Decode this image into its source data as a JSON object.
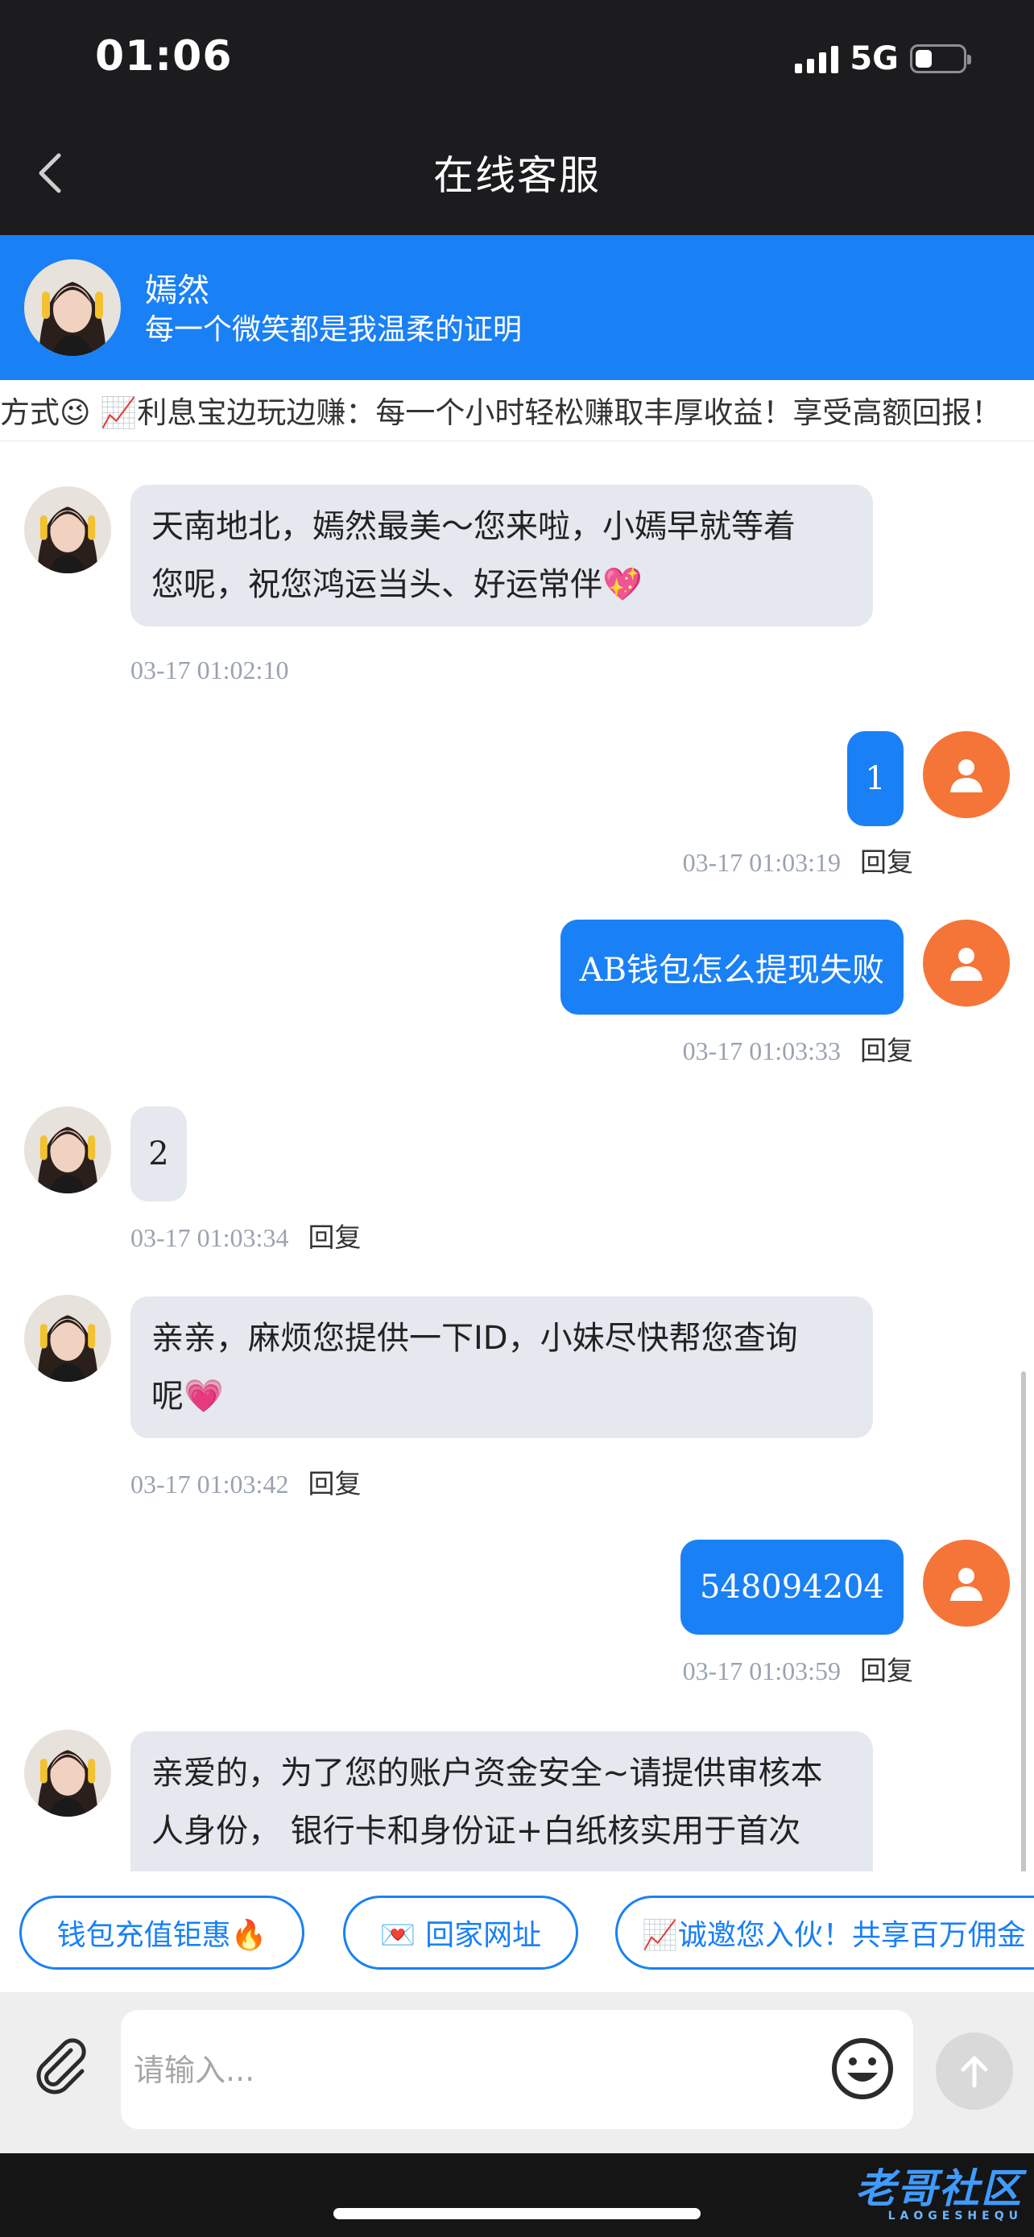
{
  "status_bar": {
    "time": "01:06",
    "network": "5G",
    "battery_level": 0.35
  },
  "nav": {
    "title": "在线客服"
  },
  "agent": {
    "name": "嫣然",
    "motto": "每一个微笑都是我温柔的证明"
  },
  "marquee": {
    "text": "方式😉 📈利息宝边玩边赚：每一个小时轻松赚取丰厚收益！享受高额回报！"
  },
  "messages": [
    {
      "from": "agent",
      "lines": [
        "天南地北，嫣然最美～您来啦，小嫣早就等着",
        "您呢，祝您鸿运当头、好运常伴💖"
      ],
      "time": "03-17 01:02:10"
    },
    {
      "from": "user",
      "text": "1",
      "time": "03-17 01:03:19",
      "reply": "回复"
    },
    {
      "from": "user",
      "text": "AB钱包怎么提现失败",
      "time": "03-17 01:03:33",
      "reply": "回复"
    },
    {
      "from": "agent",
      "lines": [
        "2"
      ],
      "time": "03-17 01:03:34",
      "reply": "回复"
    },
    {
      "from": "agent",
      "lines": [
        "亲亲，麻烦您提供一下ID，小妹尽快帮您查询",
        "呢💗"
      ],
      "time": "03-17 01:03:42",
      "reply": "回复"
    },
    {
      "from": "user",
      "text": "548094204",
      "time": "03-17 01:03:59",
      "reply": "回复"
    },
    {
      "from": "agent",
      "lines": [
        "亲爱的，为了您的账户资金安全~请提供审核本",
        "人身份， 银行卡和身份证+白纸核实用于首次"
      ]
    }
  ],
  "quick_actions": [
    "钱包充值钜惠🔥",
    "💌 回家网址",
    "📈诚邀您入伙！共享百万佣金"
  ],
  "input": {
    "placeholder": "请输入..."
  },
  "watermark": {
    "text": "老哥社区",
    "sub": "LAOGESHEQU"
  },
  "colors": {
    "brand_blue": "#1a80f5",
    "user_avatar": "#f57538",
    "agent_bubble": "#e5e8ee"
  },
  "icons": [
    "chevron-left-icon",
    "user-icon",
    "paperclip-icon",
    "emoji-icon",
    "arrow-up-icon"
  ]
}
